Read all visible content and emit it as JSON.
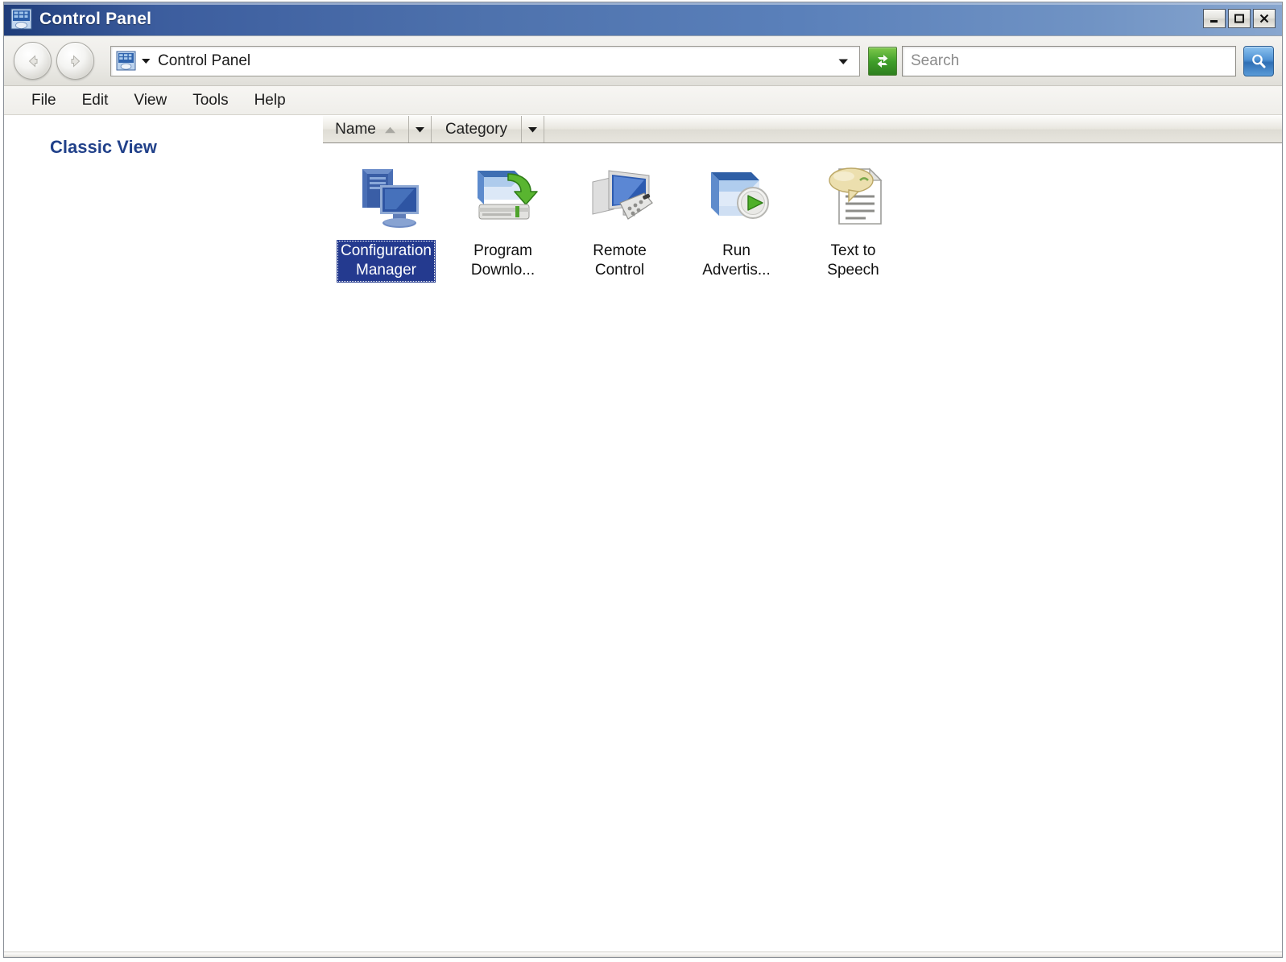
{
  "window": {
    "title": "Control Panel",
    "title_icon": "control-panel-icon",
    "controls": {
      "minimize": "Minimize",
      "maximize": "Maximize",
      "close": "Close"
    }
  },
  "toolbar": {
    "back_label": "Back",
    "forward_label": "Forward",
    "address": {
      "icon": "control-panel-icon",
      "text": "Control Panel",
      "dropdown_label": "Previous Locations"
    },
    "refresh_label": "Refresh",
    "search": {
      "value": "",
      "placeholder": "Search",
      "button_label": "Search"
    }
  },
  "menubar": {
    "items": [
      {
        "label": "File"
      },
      {
        "label": "Edit"
      },
      {
        "label": "View"
      },
      {
        "label": "Tools"
      },
      {
        "label": "Help"
      }
    ]
  },
  "sidebar": {
    "classic_view_label": "Classic View"
  },
  "columns": {
    "name": {
      "label": "Name",
      "sort": "ascending"
    },
    "category": {
      "label": "Category"
    }
  },
  "items": [
    {
      "label": "Configuration\nManager",
      "icon": "configuration-manager-icon",
      "selected": true
    },
    {
      "label": "Program\nDownlo...",
      "icon": "program-download-icon",
      "selected": false
    },
    {
      "label": "Remote\nControl",
      "icon": "remote-control-icon",
      "selected": false
    },
    {
      "label": "Run\nAdvertis...",
      "icon": "run-advertised-programs-icon",
      "selected": false
    },
    {
      "label": "Text to\nSpeech",
      "icon": "text-to-speech-icon",
      "selected": false
    }
  ],
  "colors": {
    "titlebar_start": "#1f3c7a",
    "titlebar_end": "#88a6cf",
    "selection": "#243a8f",
    "classic_view_text": "#21418a",
    "refresh_green": "#3f9e2a",
    "search_blue": "#2f6fb5"
  }
}
